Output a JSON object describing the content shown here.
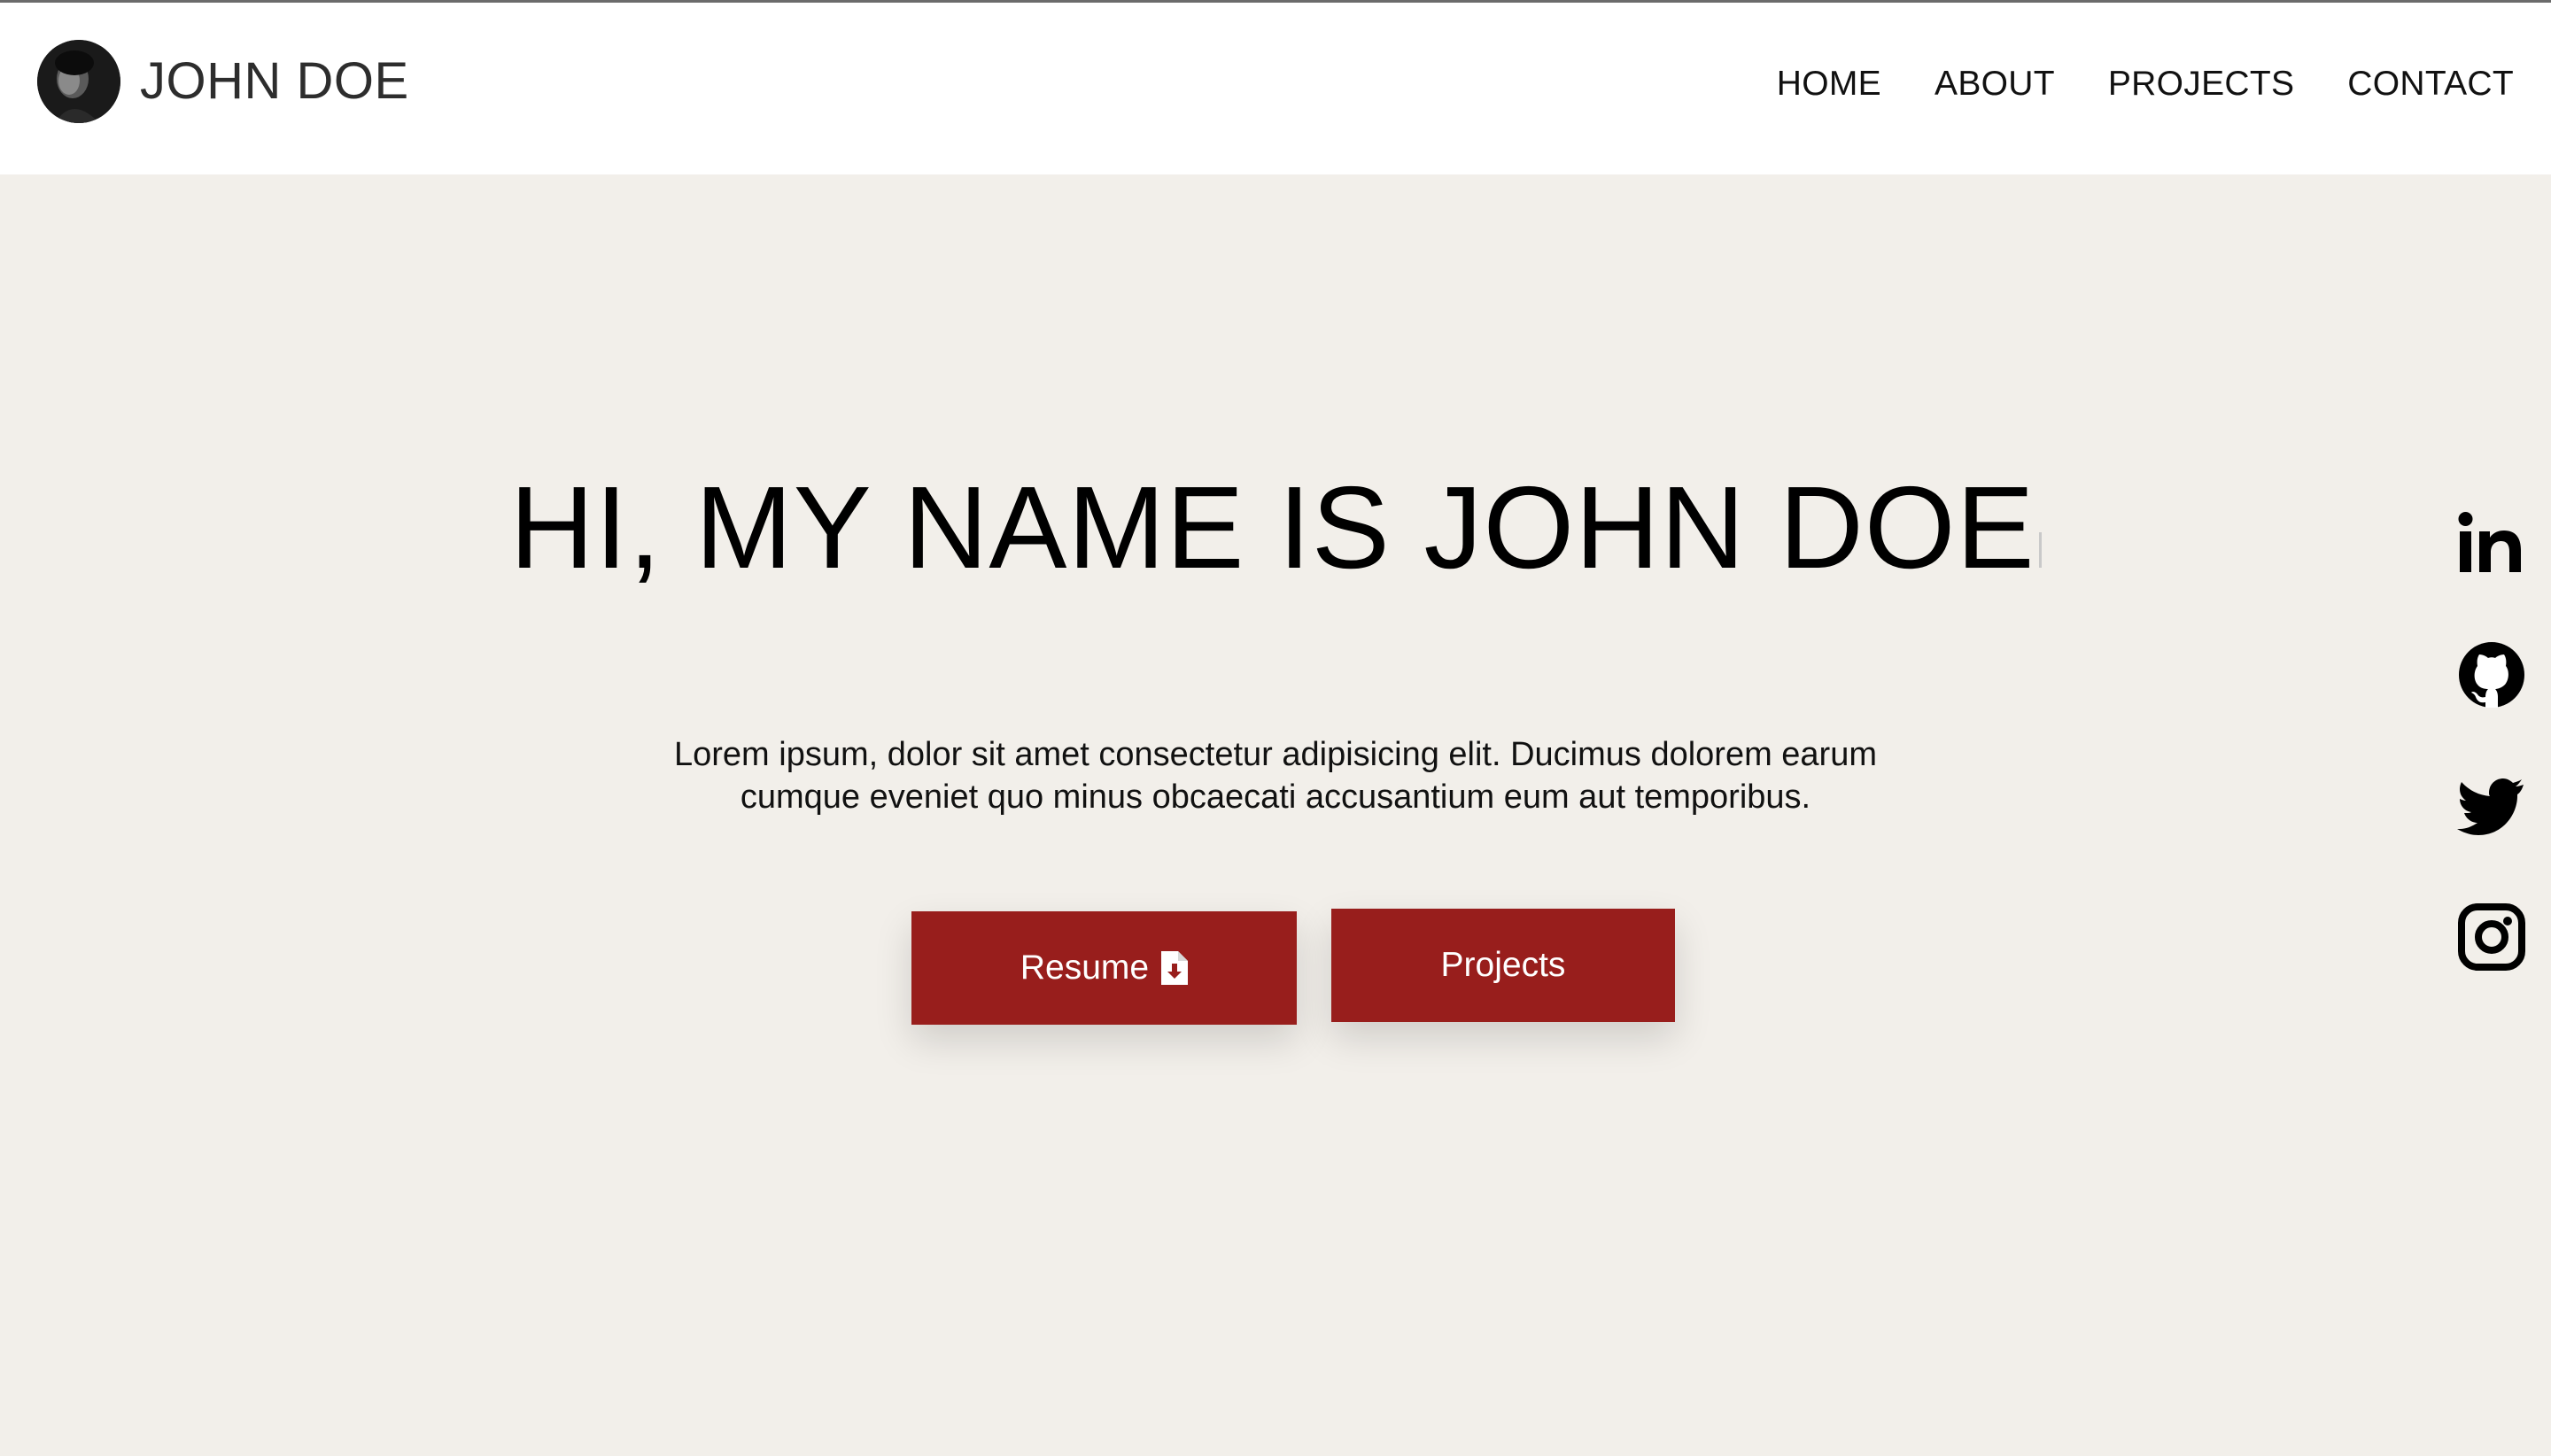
{
  "brand": {
    "name": "JOHN DOE",
    "avatar": "avatar-photo"
  },
  "nav": {
    "items": [
      {
        "label": "HOME"
      },
      {
        "label": "ABOUT"
      },
      {
        "label": "PROJECTS"
      },
      {
        "label": "CONTACT"
      }
    ]
  },
  "hero": {
    "title": "HI, MY NAME IS JOHN DOE",
    "text": "Lorem ipsum, dolor sit amet consectetur adipisicing elit. Ducimus dolorem earum cumque eveniet quo minus obcaecati accusantium eum aut temporibus.",
    "buttons": {
      "resume_label": "Resume",
      "resume_icon": "file-download-icon",
      "projects_label": "Projects"
    }
  },
  "socials": [
    {
      "icon": "linkedin-icon"
    },
    {
      "icon": "github-icon"
    },
    {
      "icon": "twitter-icon"
    },
    {
      "icon": "instagram-icon"
    }
  ],
  "colors": {
    "page_background": "#f2efea",
    "navbar_background": "#ffffff",
    "button_background": "#981e1c",
    "button_text": "#ffffff",
    "text": "#000000"
  }
}
